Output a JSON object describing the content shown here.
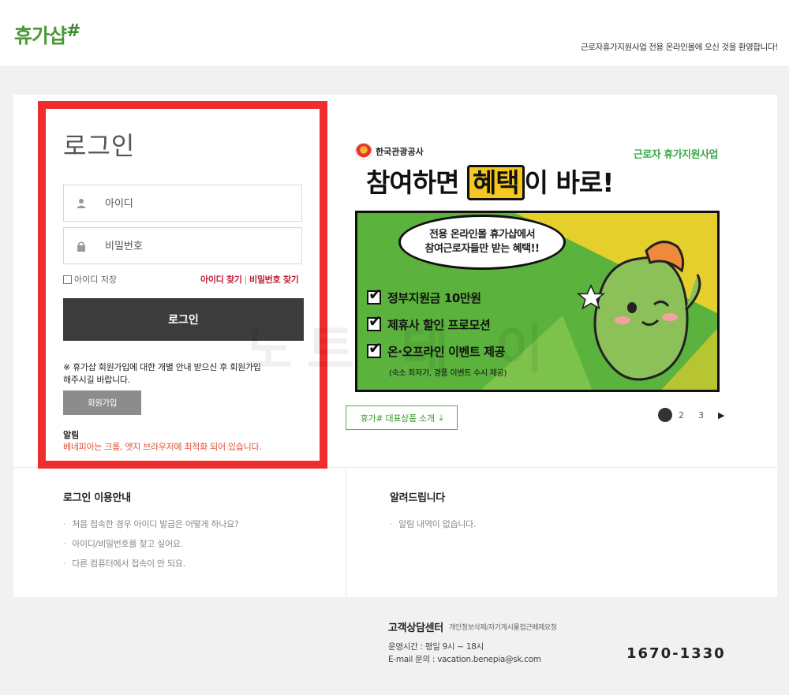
{
  "header": {
    "logo_text": "휴가샵",
    "logo_hash": "#",
    "welcome": "근로자휴가지원사업 전용 온라인몰에 오신 것을 환영합니다!"
  },
  "login": {
    "title": "로그인",
    "id_placeholder": "아이디",
    "pw_placeholder": "비밀번호",
    "save_id": "아이디 저장",
    "find_id": "아이디 찾기",
    "find_pw": "비밀번호 찾기",
    "login_button": "로그인",
    "join_note": "※ 휴가샵 회원가입에 대한 개별 안내 받으신 후 회원가입 해주시길 바랍니다.",
    "join_button": "회원가입",
    "notice_head": "알림",
    "notice_text": "베네피아는 크롬, 엣지 브라우저에 최적화 되어 있습니다."
  },
  "banner": {
    "org": "한국관광공사",
    "brand": "근로자 휴가지원사업",
    "headline_pre": "참여하면 ",
    "headline_hl": "혜택",
    "headline_post": "이 바로!",
    "bubble_line1": "전용 온라인몰 휴가샵에서",
    "bubble_line2": "참여근로자들만 받는 혜택!!",
    "checks": [
      "정부지원금 10만원",
      "제휴사 할인 프로모션",
      "온·오프라인 이벤트 제공"
    ],
    "sub": "(숙소 최저가, 경품 이벤트 수시 제공)",
    "colors": {
      "panel": "#5bb23c",
      "highlight": "#f4c81f",
      "frame": "#ef2d2d"
    }
  },
  "watermark": "노트 테 이",
  "product_button": "휴가# 대표상품 소개",
  "pager": {
    "pages": [
      "2",
      "3"
    ],
    "next": "▶"
  },
  "info": {
    "left_title": "로그인 이용안내",
    "left_items": [
      "처음 접속한 경우 아이디 발급은 어떻게 하나요?",
      "아이디/비밀번호를 찾고 싶어요.",
      "다른 컴퓨터에서 접속이 안 되요."
    ],
    "right_title": "알려드립니다",
    "right_items": [
      "알림 내역이 없습니다."
    ]
  },
  "cs": {
    "title": "고객상담센터",
    "sub": "개인정보삭제/자기게시물접근배제요청",
    "hours": "운영시간 : 평일 9시 ~ 18시",
    "email": "E-mail 문의 : vacation.benepia@sk.com",
    "phone": "1670-1330"
  }
}
